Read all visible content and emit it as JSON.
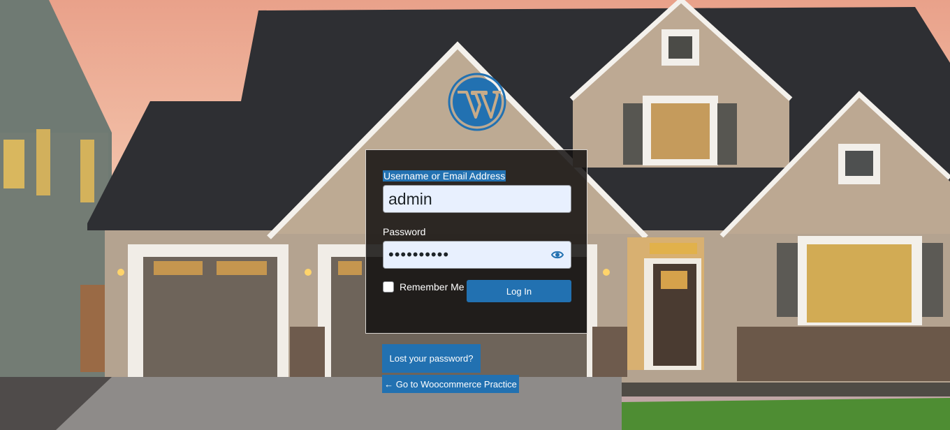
{
  "login": {
    "username_label": "Username or Email Address",
    "username_value": "admin",
    "password_label": "Password",
    "password_value": "••••••••••",
    "remember_label": "Remember Me",
    "login_button": "Log In"
  },
  "links": {
    "lost_password": "Lost your password?",
    "back_to_site": "← Go to Woocommerce Practice"
  },
  "icons": {
    "logo": "wordpress-logo-icon",
    "password_toggle": "eye-icon"
  },
  "colors": {
    "accent": "#2271b1",
    "input_bg": "#e8f0fe",
    "box_bg": "#141210"
  }
}
